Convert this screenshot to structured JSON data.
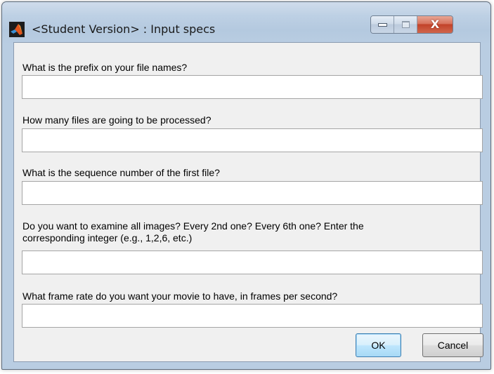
{
  "window": {
    "title": "<Student Version> : Input specs",
    "controls": {
      "minimize": "minimize",
      "maximize": "maximize",
      "close_glyph": "X"
    }
  },
  "form": {
    "fields": [
      {
        "label": "What is the prefix on your file names?",
        "value": ""
      },
      {
        "label": "How many files are going to be processed?",
        "value": ""
      },
      {
        "label": "What is the sequence number of the first file?",
        "value": ""
      },
      {
        "label": "Do you want to examine all images?  Every 2nd one?  Every 6th one?  Enter the",
        "label_line2": "corresponding integer (e.g., 1,2,6, etc.)",
        "value": ""
      },
      {
        "label": "What frame rate do you want your movie to have, in frames per second?",
        "value": ""
      }
    ]
  },
  "buttons": {
    "ok": "OK",
    "cancel": "Cancel"
  },
  "icons": {
    "app": "matlab-icon"
  }
}
